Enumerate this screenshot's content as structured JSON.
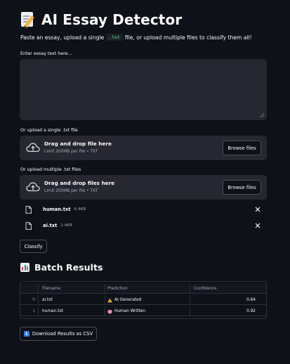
{
  "app": {
    "title": "AI Essay Detector",
    "subtitle_before": "Paste an essay, upload a single",
    "subtitle_code": ".txt",
    "subtitle_after": "file, or upload multiple files to classify them all!"
  },
  "essay_input": {
    "label": "Enter essay text here...",
    "value": "",
    "placeholder": ""
  },
  "single_upload": {
    "label": "Or upload a single .txt file",
    "title": "Drag and drop file here",
    "limit": "Limit 200MB per file • TXT",
    "browse_label": "Browse files"
  },
  "multi_upload": {
    "label": "Or upload multiple .txt files",
    "title": "Drag and drop files here",
    "limit": "Limit 200MB per file • TXT",
    "browse_label": "Browse files"
  },
  "uploaded_files": [
    {
      "name": "human.txt",
      "size": "6.4KB"
    },
    {
      "name": "ai.txt",
      "size": "2.4KB"
    }
  ],
  "classify_label": "Classify",
  "results": {
    "title": "Batch Results",
    "columns": [
      "",
      "Filename",
      "Prediction",
      "Confidence"
    ],
    "rows": [
      {
        "index": "0",
        "filename": "ai.txt",
        "prediction_icon": "warning-icon",
        "prediction": "AI Generated",
        "confidence": "0.64"
      },
      {
        "index": "1",
        "filename": "human.txt",
        "prediction_icon": "brain-icon",
        "prediction": "Human Written",
        "confidence": "0.92"
      }
    ]
  },
  "download_label": "Download Results as CSV",
  "colors": {
    "background": "#0e1117",
    "surface": "#262730",
    "text": "#fafafa",
    "code_text": "#5ce488",
    "muted": "#a3a8b8"
  }
}
